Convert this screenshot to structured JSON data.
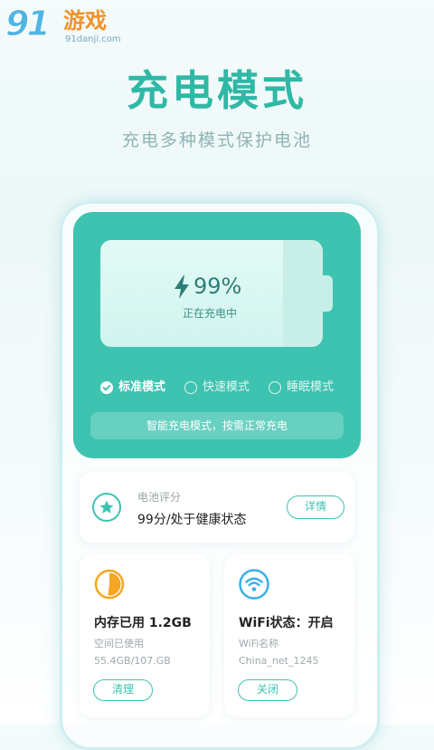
{
  "watermark": {
    "number": "91",
    "text": "游戏",
    "url": "91danji.com"
  },
  "headline": "充电模式",
  "subline": "充电多种模式保护电池",
  "battery": {
    "percent_text": "99%",
    "level": 0.82,
    "status": "正在充电中",
    "icon": "lightning-bolt-icon"
  },
  "modes": [
    {
      "label": "标准模式",
      "selected": true
    },
    {
      "label": "快速模式",
      "selected": false
    },
    {
      "label": "睡眠模式",
      "selected": false
    }
  ],
  "mode_hint": "智能充电模式，按需正常充电",
  "score": {
    "label": "电池评分",
    "value": "99分/处于健康状态",
    "button": "详情",
    "icon": "star-icon"
  },
  "memory": {
    "title": "内存已用 1.2GB",
    "sub_label": "空间已使用",
    "sub_value": "55.4GB/107.GB",
    "button": "清理",
    "used_fraction": 0.52,
    "icon": "pie-chart-icon"
  },
  "wifi": {
    "title": "WiFi状态：开启",
    "sub_label": "WiFi名称",
    "sub_value": "China_net_1245",
    "button": "关闭",
    "icon": "wifi-icon"
  },
  "colors": {
    "accent": "#3ec3b0",
    "headline": "#2fb8a5",
    "orange": "#f5a623",
    "wifi_blue": "#3ab0e6"
  }
}
